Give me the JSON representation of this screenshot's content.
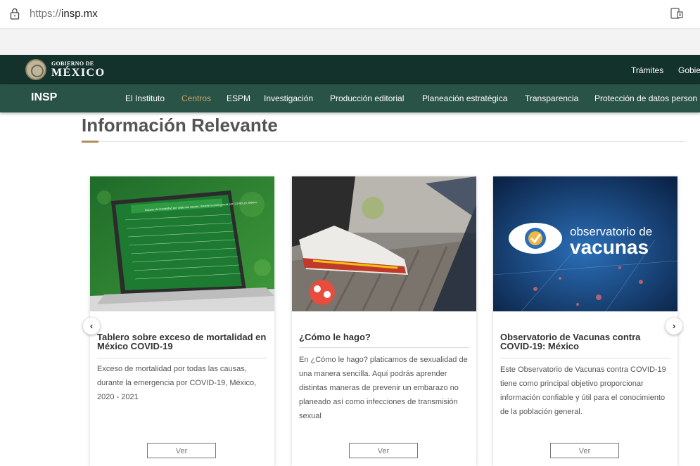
{
  "browser": {
    "url_prefix": "https://",
    "url_host": "insp.mx"
  },
  "gov_header": {
    "line1": "GOBIERNO DE",
    "line2": "MÉXICO",
    "links": [
      "Trámites",
      "Gobie"
    ]
  },
  "insp_nav": {
    "logo": "INSP",
    "items": [
      "El Instituto",
      "Centros",
      "ESPM",
      "Investigación",
      "Producción editorial",
      "Planeación estratégica",
      "Transparencia",
      "Protección de datos person"
    ],
    "active": "Centros"
  },
  "section": {
    "title": "Información Relevante"
  },
  "cards": [
    {
      "title": "Tablero sobre exceso de mortalidad en México COVID-19",
      "description": "Exceso de mortalidad por todas las causas, durante la emergencia por COVID-19, México, 2020 - 2021",
      "button": "Ver"
    },
    {
      "title": "¿Cómo le hago?",
      "description": "En ¿Cómo le hago? platicamos de sexualidad de una manera sencilla. Aquí podrás aprender distintas maneras de prevenir un embarazo no planeado así como infecciones de transmisión sexual",
      "button": "Ver"
    },
    {
      "title": "Observatorio de Vacunas contra COVID-19: México",
      "description": "Este Observatorio de Vacunas contra COVID-19 tiene como principal objetivo proporcionar información confiable y útil para el conocimiento de la población general.",
      "button": "Ver"
    }
  ],
  "card_images": {
    "laptop_header": "Exceso de mortalidad por todas las causas, durante la emergencia por COVID-19, México",
    "vaccines_line1": "observatorio de",
    "vaccines_line2": "vacunas"
  },
  "carousel": {
    "prev_icon": "chevron-left-icon",
    "next_icon": "chevron-right-icon",
    "prev_glyph": "‹",
    "next_glyph": "›"
  },
  "colors": {
    "gov_green": "#13322b",
    "insp_green": "#2a5347",
    "gold": "#b38e5d"
  }
}
